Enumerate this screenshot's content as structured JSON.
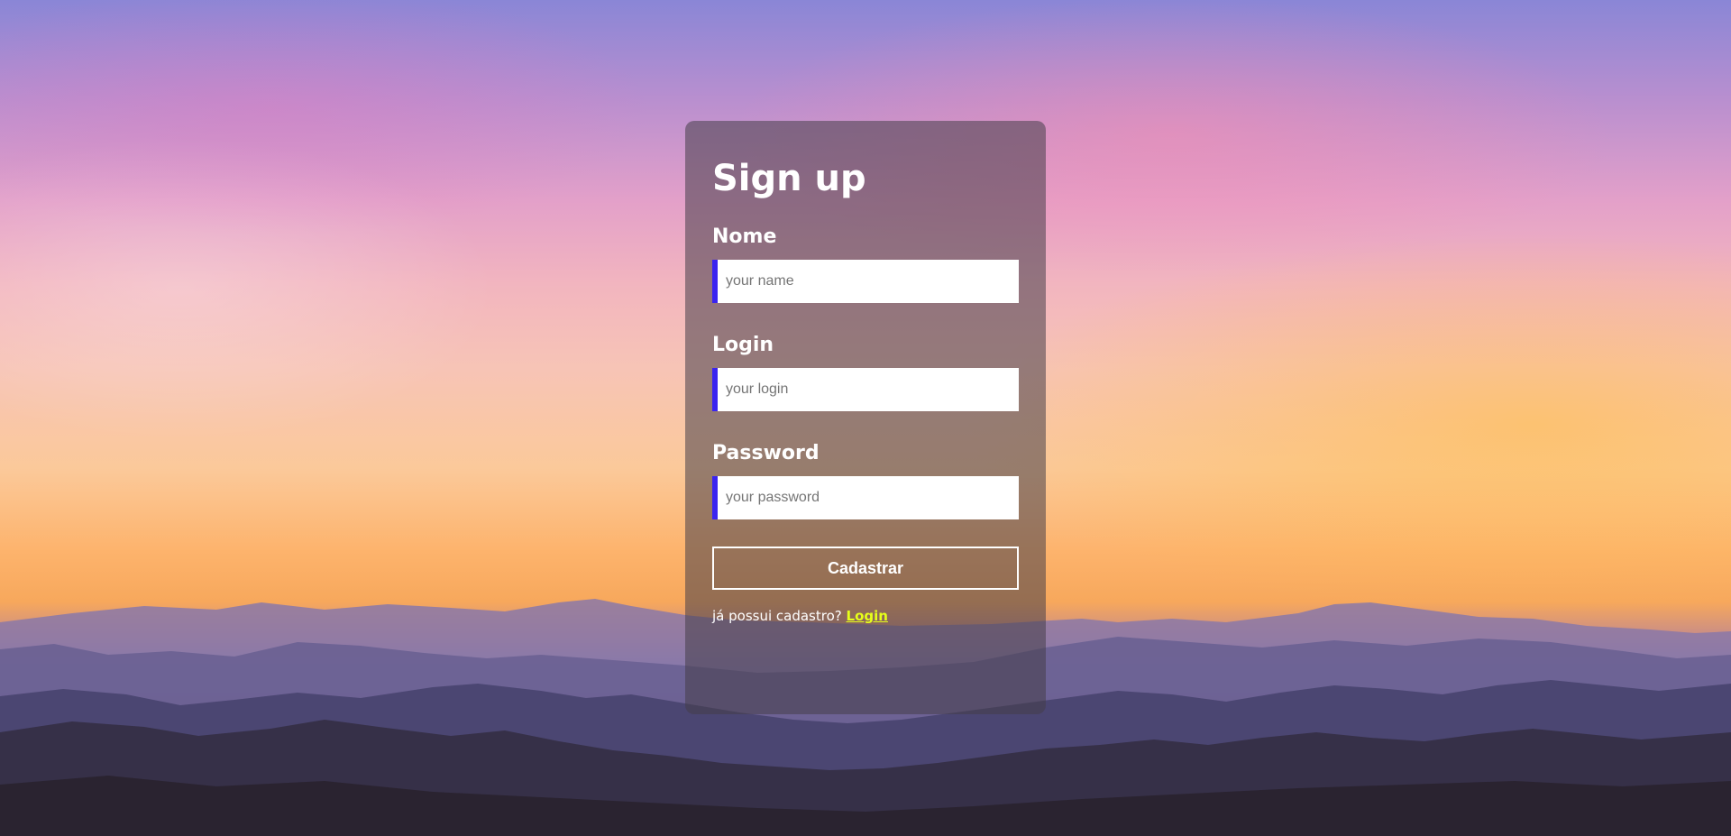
{
  "form": {
    "title": "Sign up",
    "fields": [
      {
        "label": "Nome",
        "placeholder": "your name",
        "value": ""
      },
      {
        "label": "Login",
        "placeholder": "your login",
        "value": ""
      },
      {
        "label": "Password",
        "placeholder": "your password",
        "value": ""
      }
    ],
    "submit_label": "Cadastrar",
    "footer_text": "já possui cadastro?",
    "footer_link": "Login"
  },
  "colors": {
    "input_accent": "#3a24f0",
    "link": "#e6ff1a",
    "card_background": "rgba(70,62,72,0.55)"
  }
}
